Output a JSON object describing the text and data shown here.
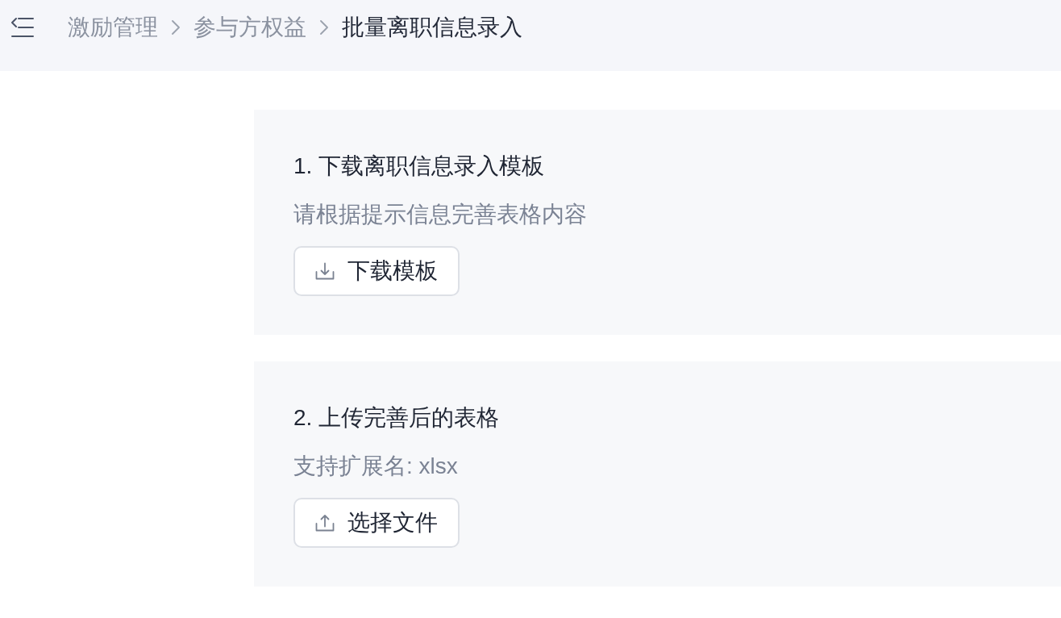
{
  "header": {
    "breadcrumb": [
      {
        "label": "激励管理",
        "current": false
      },
      {
        "label": "参与方权益",
        "current": false
      },
      {
        "label": "批量离职信息录入",
        "current": true
      }
    ]
  },
  "steps": [
    {
      "title": "1. 下载离职信息录入模板",
      "hint": "请根据提示信息完善表格内容",
      "button": {
        "kind": "download",
        "label": "下载模板"
      }
    },
    {
      "title": "2. 上传完善后的表格",
      "hint": "支持扩展名: xlsx",
      "button": {
        "kind": "upload",
        "label": "选择文件"
      }
    }
  ]
}
